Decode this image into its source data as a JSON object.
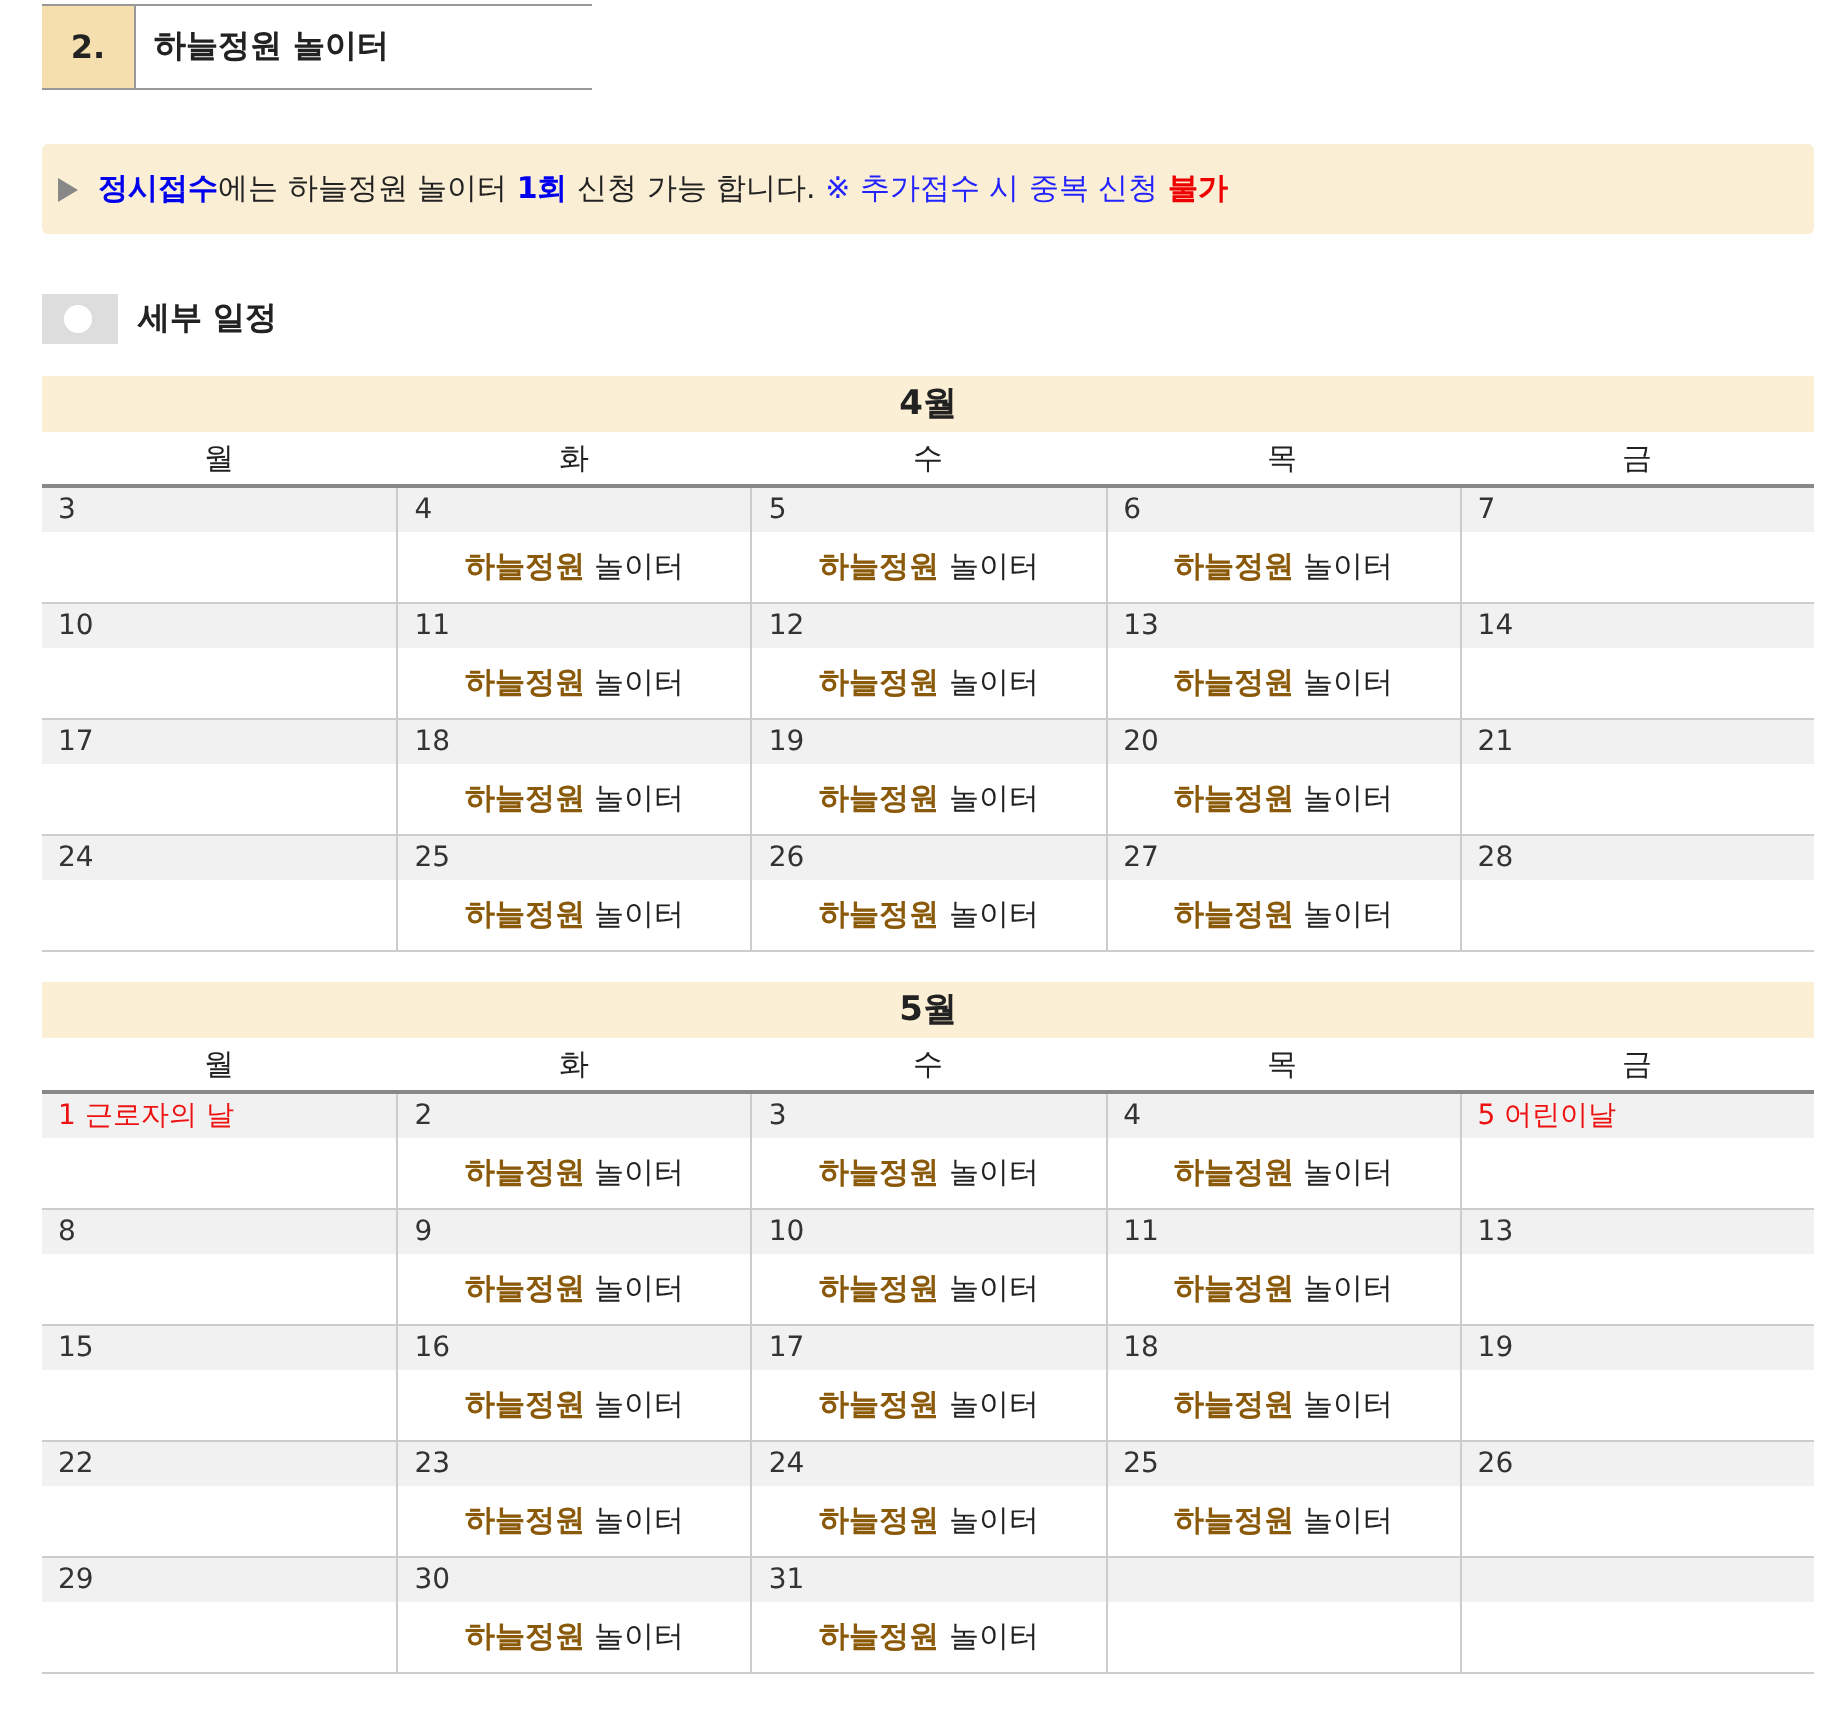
{
  "section": {
    "number": "2.",
    "title": "하늘정원 놀이터"
  },
  "notice": [
    {
      "text": "정시접수",
      "kind": "em"
    },
    {
      "text": "에는 하늘정원 놀이터 ",
      "kind": "plain"
    },
    {
      "text": "1회",
      "kind": "em"
    },
    {
      "text": " 신청 가능 합니다. ",
      "kind": "plain"
    },
    {
      "text": "※ 추가접수 시 중복 신청 ",
      "kind": "note"
    },
    {
      "text": "불가",
      "kind": "warn"
    }
  ],
  "subheading": "세부 일정",
  "months": [
    {
      "title": "4월",
      "weekdays": [
        "월",
        "화",
        "수",
        "목",
        "금"
      ],
      "weeks": [
        [
          {
            "date": "3",
            "holiday": false
          },
          {
            "date": "4",
            "holiday": false,
            "event": "**하늘정원** 놀이터"
          },
          {
            "date": "5",
            "holiday": false,
            "event": "**하늘정원** 놀이터"
          },
          {
            "date": "6",
            "holiday": false,
            "event": "**하늘정원** 놀이터"
          },
          {
            "date": "7",
            "holiday": false
          }
        ],
        [
          {
            "date": "10",
            "holiday": false
          },
          {
            "date": "11",
            "holiday": false,
            "event": "**하늘정원** 놀이터"
          },
          {
            "date": "12",
            "holiday": false,
            "event": "**하늘정원** 놀이터"
          },
          {
            "date": "13",
            "holiday": false,
            "event": "**하늘정원** 놀이터"
          },
          {
            "date": "14",
            "holiday": false
          }
        ],
        [
          {
            "date": "17",
            "holiday": false
          },
          {
            "date": "18",
            "holiday": false,
            "event": "**하늘정원** 놀이터"
          },
          {
            "date": "19",
            "holiday": false,
            "event": "**하늘정원** 놀이터"
          },
          {
            "date": "20",
            "holiday": false,
            "event": "**하늘정원** 놀이터"
          },
          {
            "date": "21",
            "holiday": false
          }
        ],
        [
          {
            "date": "24",
            "holiday": false
          },
          {
            "date": "25",
            "holiday": false,
            "event": "**하늘정원** 놀이터"
          },
          {
            "date": "26",
            "holiday": false,
            "event": "**하늘정원** 놀이터"
          },
          {
            "date": "27",
            "holiday": false,
            "event": "**하늘정원** 놀이터"
          },
          {
            "date": "28",
            "holiday": false
          }
        ]
      ]
    },
    {
      "title": "5월",
      "weekdays": [
        "월",
        "화",
        "수",
        "목",
        "금"
      ],
      "weeks": [
        [
          {
            "date": "1 근로자의 날",
            "holiday": true
          },
          {
            "date": "2",
            "holiday": false,
            "event": "**하늘정원** 놀이터"
          },
          {
            "date": "3",
            "holiday": false,
            "event": "**하늘정원** 놀이터"
          },
          {
            "date": "4",
            "holiday": false,
            "event": "**하늘정원** 놀이터"
          },
          {
            "date": "5 어린이날",
            "holiday": true
          }
        ],
        [
          {
            "date": "8",
            "holiday": false
          },
          {
            "date": "9",
            "holiday": false,
            "event": "**하늘정원** 놀이터"
          },
          {
            "date": "10",
            "holiday": false,
            "event": "**하늘정원** 놀이터"
          },
          {
            "date": "11",
            "holiday": false,
            "event": "**하늘정원** 놀이터"
          },
          {
            "date": "13",
            "holiday": false
          }
        ],
        [
          {
            "date": "15",
            "holiday": false
          },
          {
            "date": "16",
            "holiday": false,
            "event": "**하늘정원** 놀이터"
          },
          {
            "date": "17",
            "holiday": false,
            "event": "**하늘정원** 놀이터"
          },
          {
            "date": "18",
            "holiday": false,
            "event": "**하늘정원** 놀이터"
          },
          {
            "date": "19",
            "holiday": false
          }
        ],
        [
          {
            "date": "22",
            "holiday": false
          },
          {
            "date": "23",
            "holiday": false,
            "event": "**하늘정원** 놀이터"
          },
          {
            "date": "24",
            "holiday": false,
            "event": "**하늘정원** 놀이터"
          },
          {
            "date": "25",
            "holiday": false,
            "event": "**하늘정원** 놀이터"
          },
          {
            "date": "26",
            "holiday": false
          }
        ],
        [
          {
            "date": "29",
            "holiday": false
          },
          {
            "date": "30",
            "holiday": false,
            "event": "**하늘정원** 놀이터"
          },
          {
            "date": "31",
            "holiday": false,
            "event": "**하늘정원** 놀이터"
          }
        ]
      ]
    }
  ]
}
